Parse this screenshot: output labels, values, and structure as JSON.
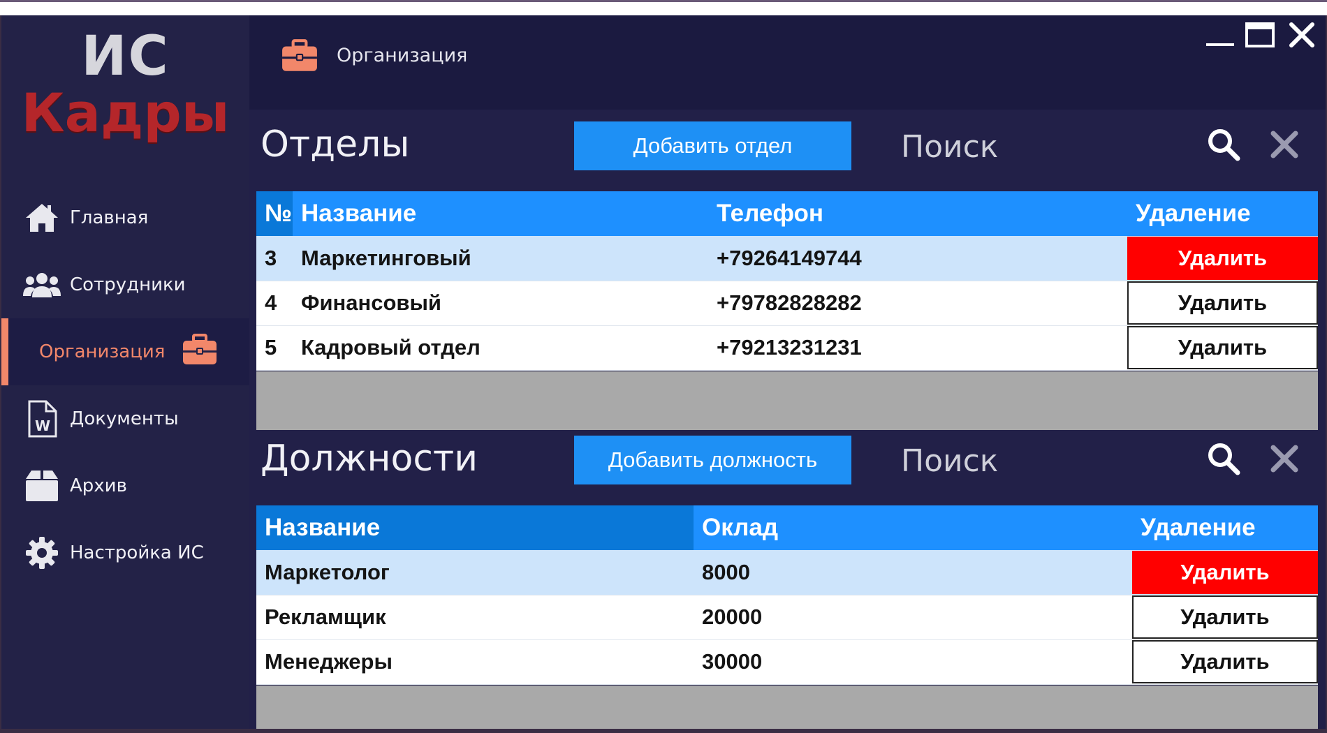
{
  "app": {
    "logo_line1": "ИС",
    "logo_line2": "Кадры"
  },
  "colors": {
    "sidebar_bg": "#232247",
    "window_bg": "#1b1a40",
    "accent": "#f2876a",
    "logo_red": "#b5262a",
    "primary_button": "#1e90f5",
    "table_header": "#1e90ff",
    "delete_active": "#ff0000",
    "row_selected": "#cde4fb",
    "empty_area": "#a9a9a9"
  },
  "sidebar": {
    "items": [
      {
        "label": "Главная",
        "icon": "home-icon"
      },
      {
        "label": "Сотрудники",
        "icon": "users-icon"
      },
      {
        "label": "Организация",
        "icon": "briefcase-icon",
        "active": true
      },
      {
        "label": "Документы",
        "icon": "word-document-icon"
      },
      {
        "label": "Архив",
        "icon": "archive-box-icon"
      },
      {
        "label": "Настройка ИС",
        "icon": "gear-icon"
      }
    ]
  },
  "header": {
    "title": "Организация",
    "icon": "briefcase-icon"
  },
  "window_controls": [
    "minimize-icon",
    "maximize-icon",
    "close-icon"
  ],
  "departments": {
    "title": "Отделы",
    "add_label": "Добавить отдел",
    "search_label": "Поиск",
    "columns": [
      "№",
      "Название",
      "Телефон",
      "Удаление"
    ],
    "rows": [
      {
        "id": "3",
        "name": "Маркетинговый",
        "phone": "+79264149744",
        "action": "Удалить"
      },
      {
        "id": "4",
        "name": "Финансовый",
        "phone": "+79782828282",
        "action": "Удалить"
      },
      {
        "id": "5",
        "name": "Кадровый отдел",
        "phone": "+79213231231",
        "action": "Удалить"
      }
    ]
  },
  "positions": {
    "title": "Должности",
    "add_label": "Добавить должность",
    "search_label": "Поиск",
    "columns": [
      "Название",
      "Оклад",
      "Удаление"
    ],
    "rows": [
      {
        "name": "Маркетолог",
        "salary": "8000",
        "action": "Удалить"
      },
      {
        "name": "Рекламщик",
        "salary": "20000",
        "action": "Удалить"
      },
      {
        "name": "Менеджеры",
        "salary": "30000",
        "action": "Удалить"
      }
    ]
  }
}
